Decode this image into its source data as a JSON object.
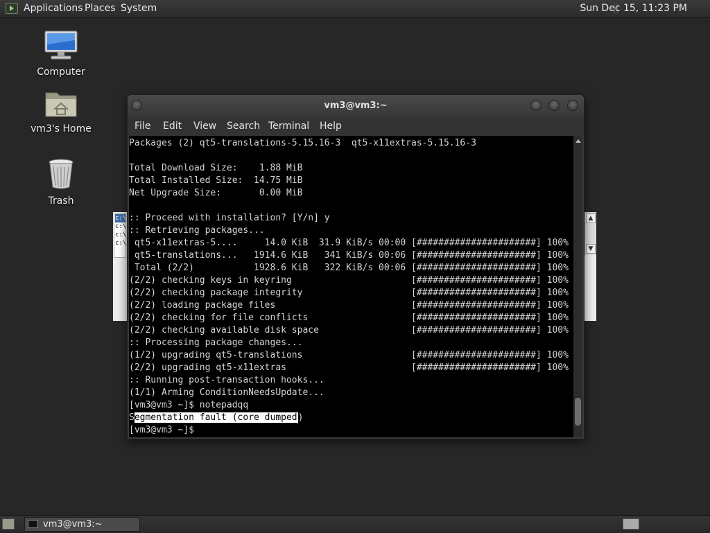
{
  "top_panel": {
    "menus": [
      "Applications",
      "Places",
      "System"
    ],
    "clock": "Sun Dec 15, 11:23 PM"
  },
  "desktop_icons": [
    {
      "label": "Computer",
      "icon": "computer-icon"
    },
    {
      "label": "vm3's Home",
      "icon": "home-folder-icon"
    },
    {
      "label": "Trash",
      "icon": "trash-icon"
    }
  ],
  "background_window": {
    "list_items": [
      "c:\\",
      "c:\\",
      "c:\\",
      "c:\\"
    ]
  },
  "terminal": {
    "title": "vm3@vm3:~",
    "menu": [
      "File",
      "Edit",
      "View",
      "Search",
      "Terminal",
      "Help"
    ],
    "lines": [
      "Packages (2) qt5-translations-5.15.16-3  qt5-x11extras-5.15.16-3",
      "",
      "Total Download Size:    1.88 MiB",
      "Total Installed Size:  14.75 MiB",
      "Net Upgrade Size:       0.00 MiB",
      "",
      ":: Proceed with installation? [Y/n] y",
      ":: Retrieving packages...",
      " qt5-x11extras-5....     14.0 KiB  31.9 KiB/s 00:00 [######################] 100%",
      " qt5-translations...   1914.6 KiB   341 KiB/s 00:06 [######################] 100%",
      " Total (2/2)           1928.6 KiB   322 KiB/s 00:06 [######################] 100%",
      "(2/2) checking keys in keyring                      [######################] 100%",
      "(2/2) checking package integrity                    [######################] 100%",
      "(2/2) loading package files                         [######################] 100%",
      "(2/2) checking for file conflicts                   [######################] 100%",
      "(2/2) checking available disk space                 [######################] 100%",
      ":: Processing package changes...",
      "(1/2) upgrading qt5-translations                    [######################] 100%",
      "(2/2) upgrading qt5-x11extras                       [######################] 100%",
      ":: Running post-transaction hooks...",
      "(1/1) Arming ConditionNeedsUpdate...",
      "[vm3@vm3 ~]$ notepadqq"
    ],
    "selected_line": {
      "first_char": "S",
      "rest": "egmentation fault (core dumped",
      "last_char": ")"
    },
    "prompt": "[vm3@vm3 ~]$"
  },
  "taskbar": {
    "task_label": "vm3@vm3:~"
  }
}
